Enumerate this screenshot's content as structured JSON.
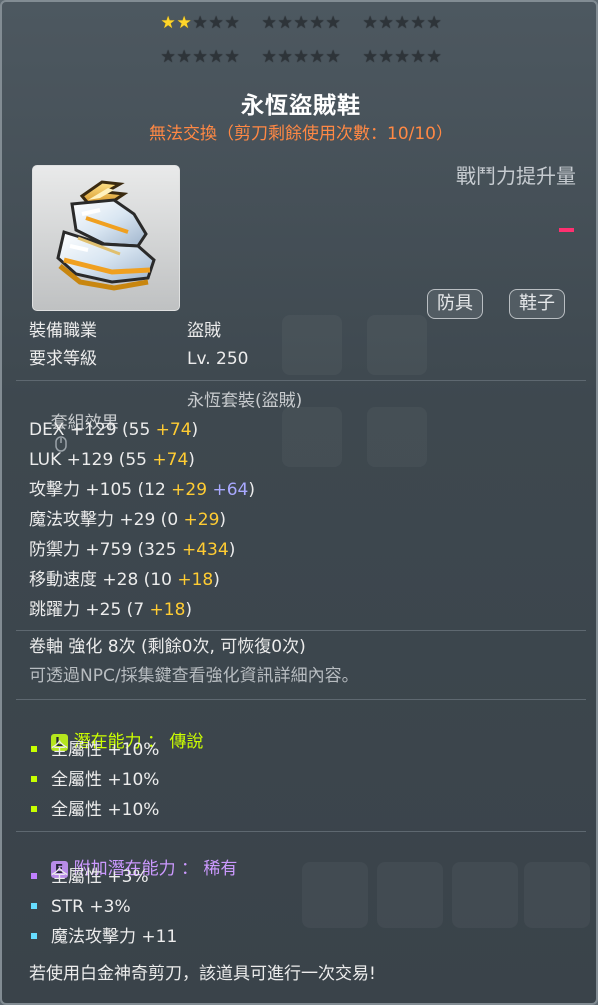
{
  "stars": {
    "filled": 2,
    "total": 25,
    "groups": 5,
    "rows": 2,
    "color_on": "#ffd52a",
    "color_off": "#2e3439"
  },
  "item": {
    "name": "永恆盜賊鞋",
    "trade_note": "無法交換（剪刀剩餘使用次數：10/10）",
    "icon": "boots-icon"
  },
  "combat_power": {
    "label": "戰鬥力提升量",
    "value": "-"
  },
  "tags": [
    "防具",
    "鞋子"
  ],
  "requirements": [
    {
      "label": "裝備職業",
      "value": "盜賊"
    },
    {
      "label": "要求等級",
      "value": "Lv. 250"
    }
  ],
  "set_effect": {
    "label": "套組效果",
    "value": "永恆套裝(盜賊)",
    "icon": "mouse-icon"
  },
  "stats": [
    {
      "name": "DEX",
      "total": "+129",
      "base": "(55",
      "bonus1": "+74",
      "bonus2": "",
      "close": ")"
    },
    {
      "name": "LUK",
      "total": "+129",
      "base": "(55",
      "bonus1": "+74",
      "bonus2": "",
      "close": ")"
    },
    {
      "name": "攻擊力",
      "total": "+105",
      "base": "(12",
      "bonus1": "+29",
      "bonus2": "+64",
      "close": ")"
    },
    {
      "name": "魔法攻擊力",
      "total": "+29",
      "base": "(0",
      "bonus1": "+29",
      "bonus2": "",
      "close": ")"
    },
    {
      "name": "防禦力",
      "total": "+759",
      "base": "(325",
      "bonus1": "+434",
      "bonus2": "",
      "close": ")"
    },
    {
      "name": "移動速度",
      "total": "+28",
      "base": "(10",
      "bonus1": "+18",
      "bonus2": "",
      "close": ")"
    },
    {
      "name": "跳躍力",
      "total": "+25",
      "base": "(7",
      "bonus1": "+18",
      "bonus2": "",
      "close": ")"
    }
  ],
  "scroll": {
    "line": "卷軸 強化 8次 (剩餘0次, 可恢復0次)",
    "hint": "可透過NPC/採集鍵查看強化資訊詳細內容。"
  },
  "potential": {
    "badge": "L",
    "title": "潛在能力 ： 傳說",
    "color": "#ccff00",
    "lines": [
      "全屬性 +10%",
      "全屬性 +10%",
      "全屬性 +10%"
    ]
  },
  "additional_potential": {
    "badge": "E",
    "title": "附加潛在能力 ： 稀有",
    "color": "#cc88ff",
    "lines": [
      "全屬性 +3%",
      "STR +3%",
      "魔法攻擊力 +11"
    ]
  },
  "footer": "若使用白金神奇剪刀，該道具可進行一次交易!"
}
